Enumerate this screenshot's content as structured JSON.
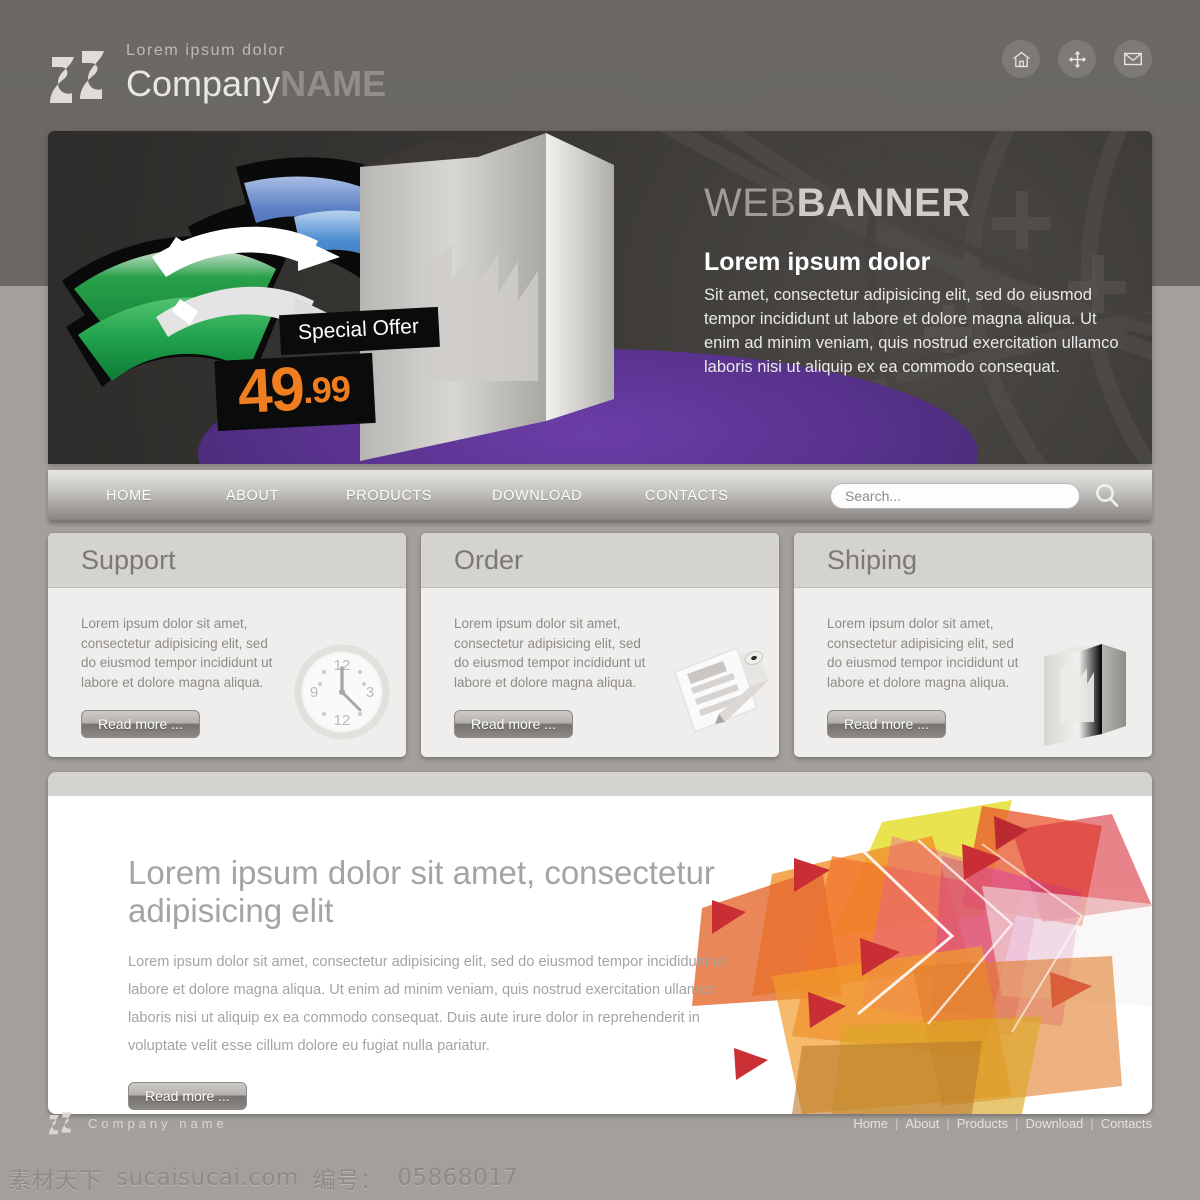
{
  "header": {
    "logo_tagline": "Lorem ipsum dolor",
    "company_first": "Company",
    "company_second": "NAME",
    "icons": [
      {
        "name": "home-icon",
        "title": "Home"
      },
      {
        "name": "sitemap-move-icon",
        "title": "Sitemap"
      },
      {
        "name": "mail-icon",
        "title": "Mail"
      }
    ]
  },
  "banner": {
    "title_light": "WEB",
    "title_bold": "BANNER",
    "subtitle": "Lorem ipsum dolor",
    "body": "Sit amet, consectetur adipisicing elit, sed do eiusmod tempor incididunt ut labore et dolore magna aliqua. Ut enim ad minim veniam, quis nostrud exercitation ullamco laboris nisi ut aliquip ex ea commodo consequat.",
    "offer_label": "Special Offer",
    "price_whole": "49",
    "price_cents": ".99"
  },
  "nav": {
    "items": [
      {
        "label": "HOME"
      },
      {
        "label": "ABOUT"
      },
      {
        "label": "PRODUCTS"
      },
      {
        "label": "DOWNLOAD"
      },
      {
        "label": "CONTACTS"
      }
    ],
    "search_placeholder": "Search...",
    "search_value": ""
  },
  "cards": [
    {
      "title": "Support",
      "body": "Lorem ipsum dolor sit amet, consectetur adipisicing elit, sed do eiusmod tempor incididunt ut labore et dolore magna aliqua.",
      "button": "Read more ...",
      "icon": "clock-icon"
    },
    {
      "title": "Order",
      "body": "Lorem ipsum dolor sit amet, consectetur adipisicing elit, sed do eiusmod tempor incididunt ut labore et dolore magna aliqua.",
      "button": "Read more ...",
      "icon": "document-pencil-icon"
    },
    {
      "title": "Shiping",
      "body": "Lorem ipsum dolor sit amet, consectetur adipisicing elit, sed do eiusmod tempor incididunt ut labore et dolore magna aliqua.",
      "button": "Read more ...",
      "icon": "product-box-icon"
    }
  ],
  "promo": {
    "heading": "Lorem ipsum dolor sit amet, consectetur adipisicing elit",
    "body": "Lorem ipsum dolor sit amet, consectetur adipisicing elit, sed do eiusmod tempor incididunt ut labore et dolore magna aliqua. Ut enim ad minim veniam, quis nostrud exercitation ullamco laboris nisi ut aliquip ex ea commodo consequat. Duis aute irure dolor in reprehenderit in voluptate velit esse cillum dolore eu fugiat nulla pariatur.",
    "button": "Read more ..."
  },
  "footer": {
    "company": "Company name",
    "links": [
      {
        "label": "Home"
      },
      {
        "label": "About"
      },
      {
        "label": "Products"
      },
      {
        "label": "Download"
      },
      {
        "label": "Contacts"
      }
    ],
    "separator": "|"
  },
  "watermark": {
    "site_cn": "素材天下",
    "site": "sucaisucai.com",
    "id_label": "编号：",
    "id_value": "05868017"
  },
  "colors": {
    "page_bg": "#a3a09c",
    "header_bg": "#6a6764",
    "accent_orange": "#ef7e21",
    "banner_purple": "#56318a",
    "card_header": "#d5d3d0"
  }
}
